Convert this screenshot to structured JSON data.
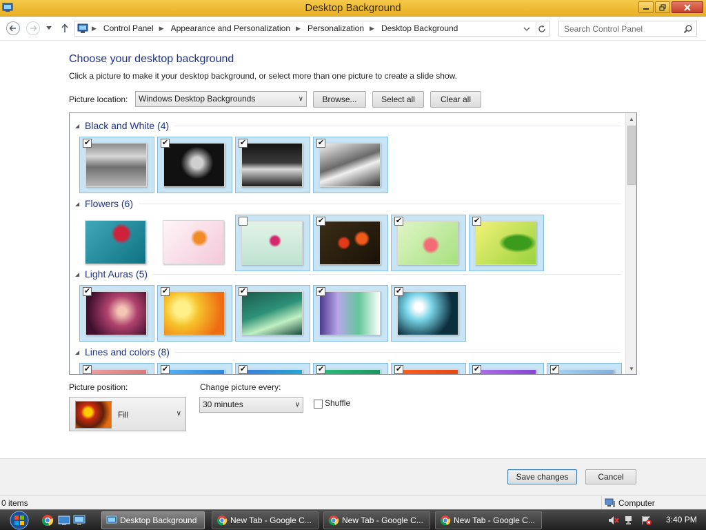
{
  "window": {
    "title": "Desktop Background"
  },
  "address_bar": {
    "breadcrumbs": [
      "Control Panel",
      "Appearance and Personalization",
      "Personalization",
      "Desktop Background"
    ],
    "search_placeholder": "Search Control Panel"
  },
  "main": {
    "heading": "Choose your desktop background",
    "subtext": "Click a picture to make it your desktop background, or select more than one picture to create a slide show.",
    "location_label": "Picture location:",
    "location_value": "Windows Desktop Backgrounds",
    "browse_label": "Browse...",
    "select_all_label": "Select all",
    "clear_all_label": "Clear all"
  },
  "groups": [
    {
      "name": "Black and White (4)",
      "thumbs": [
        {
          "style": "bw1",
          "selected": true
        },
        {
          "style": "bw2",
          "selected": true
        },
        {
          "style": "bw3",
          "selected": true
        },
        {
          "style": "bw4",
          "selected": true
        }
      ]
    },
    {
      "name": "Flowers (6)",
      "thumbs": [
        {
          "style": "fl1",
          "selected": false,
          "checkbox": false
        },
        {
          "style": "fl2",
          "selected": false,
          "checkbox": false
        },
        {
          "style": "fl3",
          "selected": false,
          "checkbox": true
        },
        {
          "style": "fl4",
          "selected": true
        },
        {
          "style": "fl5",
          "selected": true
        },
        {
          "style": "fl6",
          "selected": true
        }
      ]
    },
    {
      "name": "Light Auras (5)",
      "thumbs": [
        {
          "style": "la1",
          "selected": true
        },
        {
          "style": "la2",
          "selected": true
        },
        {
          "style": "la3",
          "selected": true
        },
        {
          "style": "la4",
          "selected": true
        },
        {
          "style": "la5",
          "selected": true
        }
      ]
    },
    {
      "name": "Lines and colors (8)",
      "thumbs": [
        {
          "style": "lc1",
          "selected": true
        },
        {
          "style": "lc2",
          "selected": true
        },
        {
          "style": "lc3",
          "selected": true
        },
        {
          "style": "lc4",
          "selected": true
        },
        {
          "style": "lc5",
          "selected": true
        },
        {
          "style": "lc6",
          "selected": true
        },
        {
          "style": "lc7",
          "selected": true
        }
      ]
    }
  ],
  "options": {
    "position_label": "Picture position:",
    "position_value": "Fill",
    "change_label": "Change picture every:",
    "change_value": "30 minutes",
    "shuffle_label": "Shuffle",
    "shuffle_checked": false
  },
  "footer": {
    "save_label": "Save changes",
    "cancel_label": "Cancel"
  },
  "status_bar": {
    "items": "0 items",
    "location": "Computer"
  },
  "taskbar": {
    "tasks": [
      {
        "label": "Desktop Background",
        "active": true
      },
      {
        "label": "New Tab - Google C...",
        "active": false
      },
      {
        "label": "New Tab - Google C...",
        "active": false
      },
      {
        "label": "New Tab - Google C...",
        "active": false
      }
    ],
    "clock": "3:40 PM"
  },
  "colors": {
    "titlebar": "#e8b024",
    "heading": "#1e3287",
    "selection": "#c9e4f4",
    "selection_border": "#84c0e4"
  }
}
